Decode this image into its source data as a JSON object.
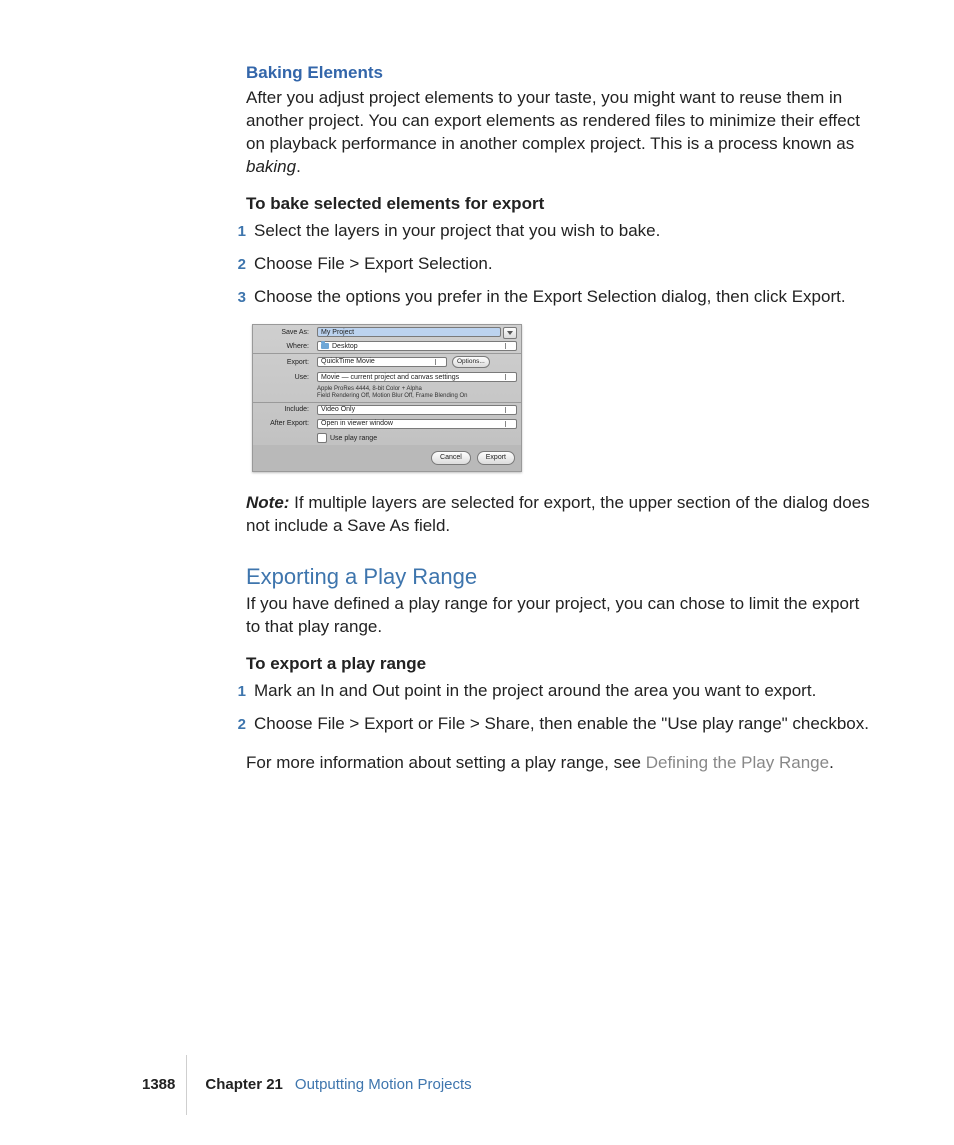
{
  "section1": {
    "heading": "Baking Elements",
    "intro_a": "After you adjust project elements to your taste, you might want to reuse them in another project. You can export elements as rendered files to minimize their effect on playback performance in another complex project. This is a process known as ",
    "intro_ital": "baking",
    "intro_b": ".",
    "task": "To bake selected elements for export",
    "steps": [
      "Select the layers in your project that you wish to bake.",
      "Choose File > Export Selection.",
      "Choose the options you prefer in the Export Selection dialog, then click Export."
    ],
    "note_label": "Note:",
    "note_body": "  If multiple layers are selected for export, the upper section of the dialog does not include a Save As field."
  },
  "dialog": {
    "saveas_label": "Save As:",
    "saveas_value": "My Project",
    "where_label": "Where:",
    "where_value": "Desktop",
    "export_label": "Export:",
    "export_value": "QuickTime Movie",
    "options_btn": "Options...",
    "use_label": "Use:",
    "use_value": "Movie — current project and canvas settings",
    "codec_line1": "Apple ProRes 4444, 8-bit Color + Alpha",
    "codec_line2": "Field Rendering Off, Motion Blur Off, Frame Blending On",
    "include_label": "Include:",
    "include_value": "Video Only",
    "after_label": "After Export:",
    "after_value": "Open in viewer window",
    "playrange_label": "Use play range",
    "cancel": "Cancel",
    "export_btn": "Export"
  },
  "section2": {
    "heading": "Exporting a Play Range",
    "intro": "If you have defined a play range for your project, you can chose to limit the export to that play range.",
    "task": "To export a play range",
    "steps": [
      "Mark an In and Out point in the project around the area you want to export.",
      "Choose File > Export or File > Share, then enable the \"Use play range\" checkbox."
    ],
    "more_a": "For more information about setting a play range, see ",
    "more_link": "Defining the Play Range",
    "more_b": "."
  },
  "footer": {
    "page": "1388",
    "chapter": "Chapter 21",
    "title": "Outputting Motion Projects"
  }
}
